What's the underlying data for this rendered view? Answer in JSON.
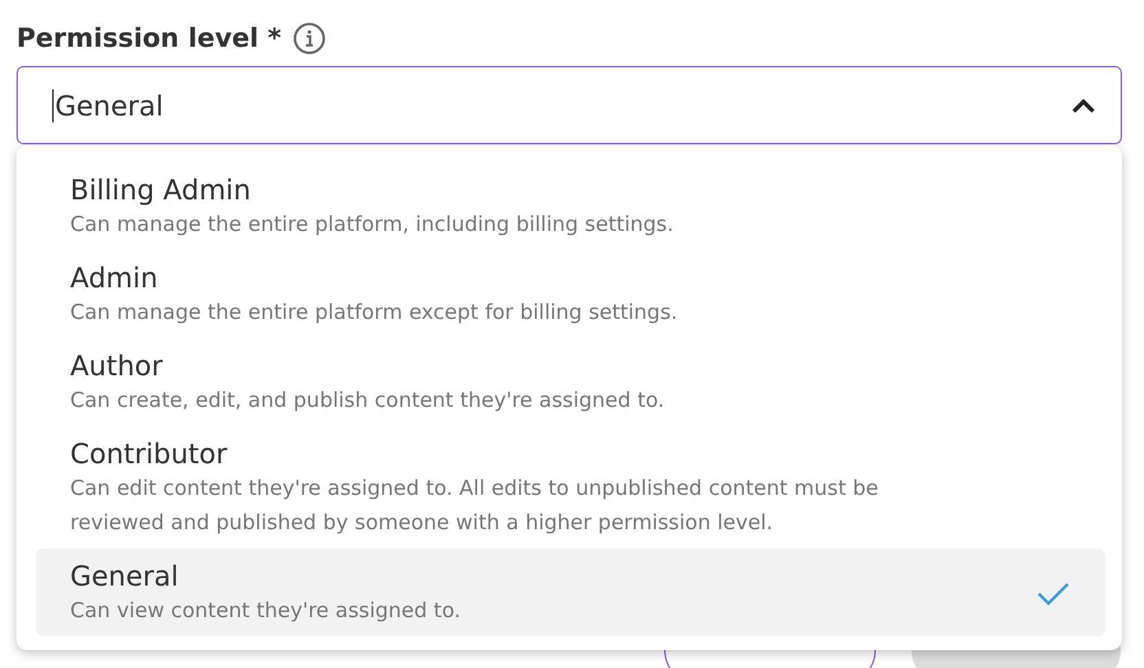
{
  "field": {
    "label": "Permission level *",
    "value": "General",
    "expanded": true
  },
  "options": [
    {
      "title": "Billing Admin",
      "description": "Can manage the entire platform, including billing settings.",
      "selected": false
    },
    {
      "title": "Admin",
      "description": "Can manage the entire platform except for billing settings.",
      "selected": false
    },
    {
      "title": "Author",
      "description": "Can create, edit, and publish content they're assigned to.",
      "selected": false
    },
    {
      "title": "Contributor",
      "description": "Can edit content they're assigned to. All edits to unpublished content must be reviewed and published by someone with a higher permission level.",
      "selected": false
    },
    {
      "title": "General",
      "description": "Can view content they're assigned to.",
      "selected": true
    }
  ],
  "buttons": [
    {
      "kind": "outline"
    },
    {
      "kind": "disabled"
    }
  ]
}
